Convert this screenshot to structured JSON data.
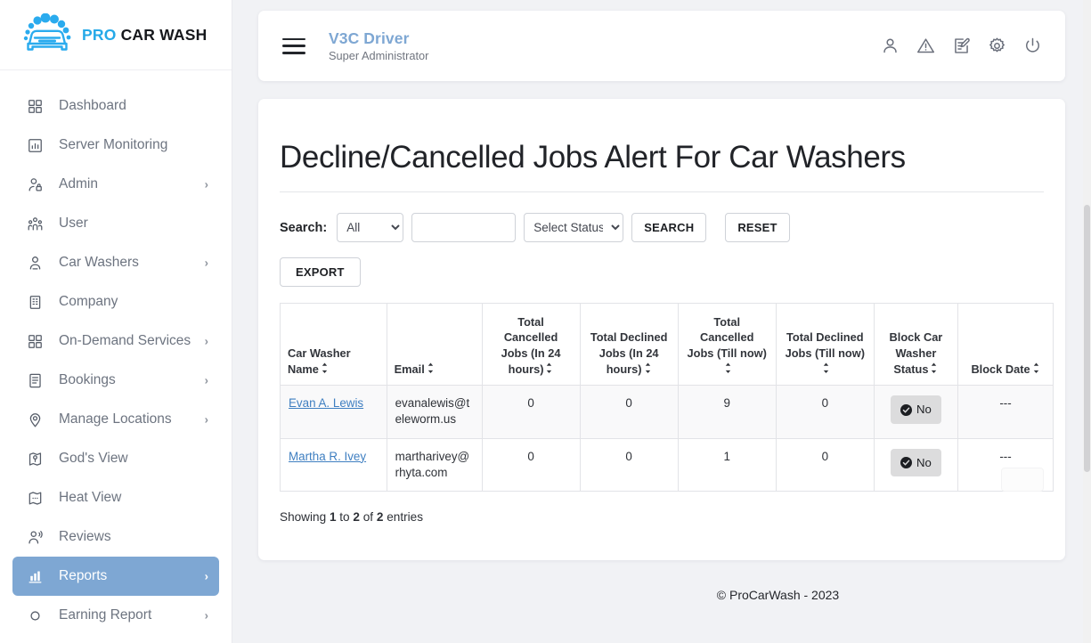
{
  "brand": {
    "logo_icon": "car-wash-logo-icon",
    "name_accent": "PRO",
    "name_rest": "CAR WASH",
    "accent_color": "#25a9e8"
  },
  "sidebar": {
    "active_color": "#7ea7d3",
    "items": [
      {
        "label": "Dashboard",
        "icon": "grid-icon",
        "caret": "",
        "active": false
      },
      {
        "label": "Server Monitoring",
        "icon": "chart-bar-icon",
        "caret": "",
        "active": false
      },
      {
        "label": "Admin",
        "icon": "user-lock-icon",
        "caret": "›",
        "active": false
      },
      {
        "label": "User",
        "icon": "users-icon",
        "caret": "",
        "active": false
      },
      {
        "label": "Car Washers",
        "icon": "user-badge-icon",
        "caret": "›",
        "active": false
      },
      {
        "label": "Company",
        "icon": "building-icon",
        "caret": "",
        "active": false
      },
      {
        "label": "On-Demand Services",
        "icon": "grid-icon",
        "caret": "›",
        "active": false
      },
      {
        "label": "Bookings",
        "icon": "document-icon",
        "caret": "›",
        "active": false
      },
      {
        "label": "Manage Locations",
        "icon": "map-pin-icon",
        "caret": "›",
        "active": false
      },
      {
        "label": "God's View",
        "icon": "map-marker-icon",
        "caret": "",
        "active": false
      },
      {
        "label": "Heat View",
        "icon": "map-heat-icon",
        "caret": "",
        "active": false
      },
      {
        "label": "Reviews",
        "icon": "user-voice-icon",
        "caret": "",
        "active": false
      },
      {
        "label": "Reports",
        "icon": "bar-chart-icon",
        "caret": "›",
        "active": true
      },
      {
        "label": "Earning Report",
        "icon": "circle-icon",
        "caret": "›",
        "active": false
      }
    ]
  },
  "topbar": {
    "menu_icon": "hamburger-menu-icon",
    "title": "V3C Driver",
    "subtitle": "Super Administrator",
    "icons": [
      {
        "name": "user-icon"
      },
      {
        "name": "warning-triangle-icon"
      },
      {
        "name": "edit-document-icon"
      },
      {
        "name": "gear-icon"
      },
      {
        "name": "power-icon"
      }
    ]
  },
  "page": {
    "title": "Decline/Cancelled Jobs Alert For Car Washers"
  },
  "filters": {
    "search_label": "Search:",
    "type_select": {
      "value": "All",
      "options": [
        "All"
      ]
    },
    "text_input": {
      "value": "",
      "placeholder": ""
    },
    "status_select": {
      "value": "Select Status",
      "options": [
        "Select Status"
      ]
    },
    "search_button": "SEARCH",
    "reset_button": "RESET",
    "export_button": "EXPORT"
  },
  "table": {
    "columns": [
      {
        "label": "Car Washer Name",
        "sortable": true,
        "align": "left"
      },
      {
        "label": "Email",
        "sortable": true,
        "align": "left"
      },
      {
        "label": "Total Cancelled Jobs (In 24 hours)",
        "sortable": true,
        "align": "center"
      },
      {
        "label": "Total Declined Jobs (In 24 hours)",
        "sortable": true,
        "align": "center"
      },
      {
        "label": "Total Cancelled Jobs (Till now)",
        "sortable": true,
        "align": "center"
      },
      {
        "label": "Total Declined Jobs (Till now)",
        "sortable": true,
        "align": "center"
      },
      {
        "label": "Block Car Washer Status",
        "sortable": true,
        "align": "center"
      },
      {
        "label": "Block Date",
        "sortable": true,
        "align": "center"
      }
    ],
    "rows": [
      {
        "name": "Evan A. Lewis",
        "email": "evanalewis@teleworm.us",
        "cancelled_24h": "0",
        "declined_24h": "0",
        "cancelled_total": "9",
        "declined_total": "0",
        "block_status": "No",
        "block_status_icon": "check-circle-icon",
        "block_date": "---"
      },
      {
        "name": "Martha R. Ivey",
        "email": "martharivey@rhyta.com",
        "cancelled_24h": "0",
        "declined_24h": "0",
        "cancelled_total": "1",
        "declined_total": "0",
        "block_status": "No",
        "block_status_icon": "check-circle-icon",
        "block_date": "---"
      }
    ]
  },
  "pagination": {
    "showing_prefix": "Showing",
    "from": "1",
    "to_word": "to",
    "to": "2",
    "of_word": "of",
    "total": "2",
    "entries_word": "entries"
  },
  "footer": {
    "text": "© ProCarWash - 2023"
  }
}
